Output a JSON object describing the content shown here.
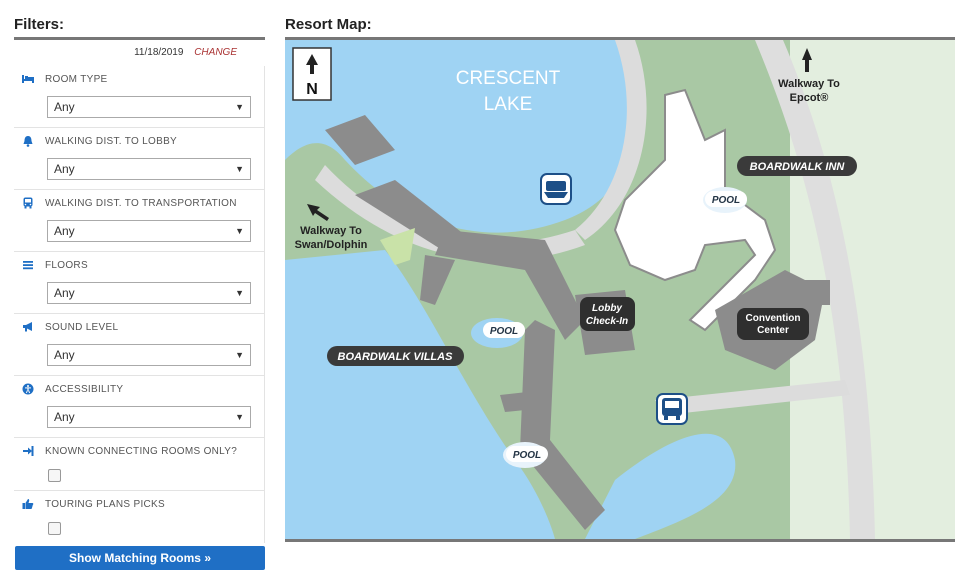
{
  "filters": {
    "title": "Filters:",
    "date": "11/18/2019",
    "change_label": "CHANGE",
    "items": [
      {
        "label": "ROOM TYPE",
        "icon": "bed-icon",
        "value": "Any"
      },
      {
        "label": "WALKING DIST. TO LOBBY",
        "icon": "bell-icon",
        "value": "Any"
      },
      {
        "label": "WALKING DIST. TO TRANSPORTATION",
        "icon": "bus-icon",
        "value": "Any"
      },
      {
        "label": "FLOORS",
        "icon": "list-icon",
        "value": "Any"
      },
      {
        "label": "SOUND LEVEL",
        "icon": "megaphone-icon",
        "value": "Any"
      },
      {
        "label": "ACCESSIBILITY",
        "icon": "accessibility-icon",
        "value": "Any"
      }
    ],
    "checks": [
      {
        "label": "KNOWN CONNECTING ROOMS ONLY?",
        "icon": "sign-in-icon",
        "checked": false
      },
      {
        "label": "TOURING PLANS PICKS",
        "icon": "thumbs-up-icon",
        "checked": false
      }
    ],
    "button_label": "Show Matching Rooms »"
  },
  "map": {
    "title": "Resort Map:",
    "north": "N",
    "lake_line1": "CRESCENT",
    "lake_line2": "LAKE",
    "walkway_epcot_1": "Walkway To",
    "walkway_epcot_2": "Epcot®",
    "walkway_swan_1": "Walkway To",
    "walkway_swan_2": "Swan/Dolphin",
    "boardwalk_inn": "BOARDWALK INN",
    "boardwalk_villas": "BOARDWALK VILLAS",
    "lobby_1": "Lobby",
    "lobby_2": "Check-In",
    "convention_1": "Convention",
    "convention_2": "Center",
    "pool": "POOL",
    "colors": {
      "water": "#9fd3f3",
      "land": "#a9c8a4",
      "building": "#8c8c8c",
      "path": "#dcdcdc"
    }
  }
}
